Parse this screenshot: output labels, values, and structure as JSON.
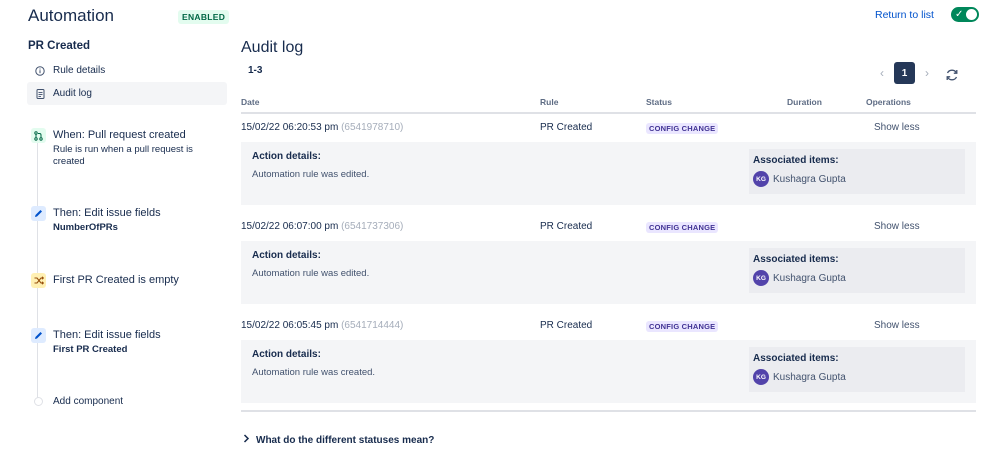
{
  "header": {
    "title": "Automation",
    "enabled_badge": "ENABLED",
    "return_link": "Return to list",
    "toggle_on": true
  },
  "sidebar": {
    "rule_name": "PR Created",
    "nav": [
      {
        "label": "Rule details",
        "icon": "info-icon"
      },
      {
        "label": "Audit log",
        "icon": "document-icon",
        "active": true
      }
    ],
    "components": [
      {
        "type": "trigger",
        "icon": "pull-request-icon",
        "title": "When: Pull request created",
        "subtitle": "Rule is run when a pull request is created"
      },
      {
        "type": "action",
        "icon": "pencil-icon",
        "title": "Then: Edit issue fields",
        "subtitle": "NumberOfPRs"
      },
      {
        "type": "condition",
        "icon": "shuffle-icon",
        "title": "First PR Created is empty",
        "subtitle": ""
      },
      {
        "type": "action",
        "icon": "pencil-icon",
        "title": "Then: Edit issue fields",
        "subtitle": "First PR Created"
      }
    ],
    "add_component": "Add component"
  },
  "main": {
    "title": "Audit log",
    "range": "1-3",
    "pager": {
      "current_page": "1",
      "prev": "‹",
      "next": "›"
    },
    "columns": {
      "date": "Date",
      "rule": "Rule",
      "status": "Status",
      "duration": "Duration",
      "operations": "Operations"
    },
    "entries": [
      {
        "date": "15/02/22 06:20:53 pm",
        "id": "(6541978710)",
        "rule": "PR Created",
        "status": "CONFIG CHANGE",
        "duration": "",
        "ops": "Show less",
        "details_label": "Action details:",
        "details_text": "Automation rule was edited.",
        "assoc_label": "Associated items:",
        "assoc_initials": "KG",
        "assoc_name": "Kushagra Gupta"
      },
      {
        "date": "15/02/22 06:07:00 pm",
        "id": "(6541737306)",
        "rule": "PR Created",
        "status": "CONFIG CHANGE",
        "duration": "",
        "ops": "Show less",
        "details_label": "Action details:",
        "details_text": "Automation rule was edited.",
        "assoc_label": "Associated items:",
        "assoc_initials": "KG",
        "assoc_name": "Kushagra Gupta"
      },
      {
        "date": "15/02/22 06:05:45 pm",
        "id": "(6541714444)",
        "rule": "PR Created",
        "status": "CONFIG CHANGE",
        "duration": "",
        "ops": "Show less",
        "details_label": "Action details:",
        "details_text": "Automation rule was created.",
        "assoc_label": "Associated items:",
        "assoc_initials": "KG",
        "assoc_name": "Kushagra Gupta"
      }
    ],
    "faq": "What do the different statuses mean?"
  },
  "colors": {
    "accent": "#0052CC",
    "toggle": "#00875A",
    "status_badge": "#EAE6FF",
    "avatar": "#5243AA"
  }
}
